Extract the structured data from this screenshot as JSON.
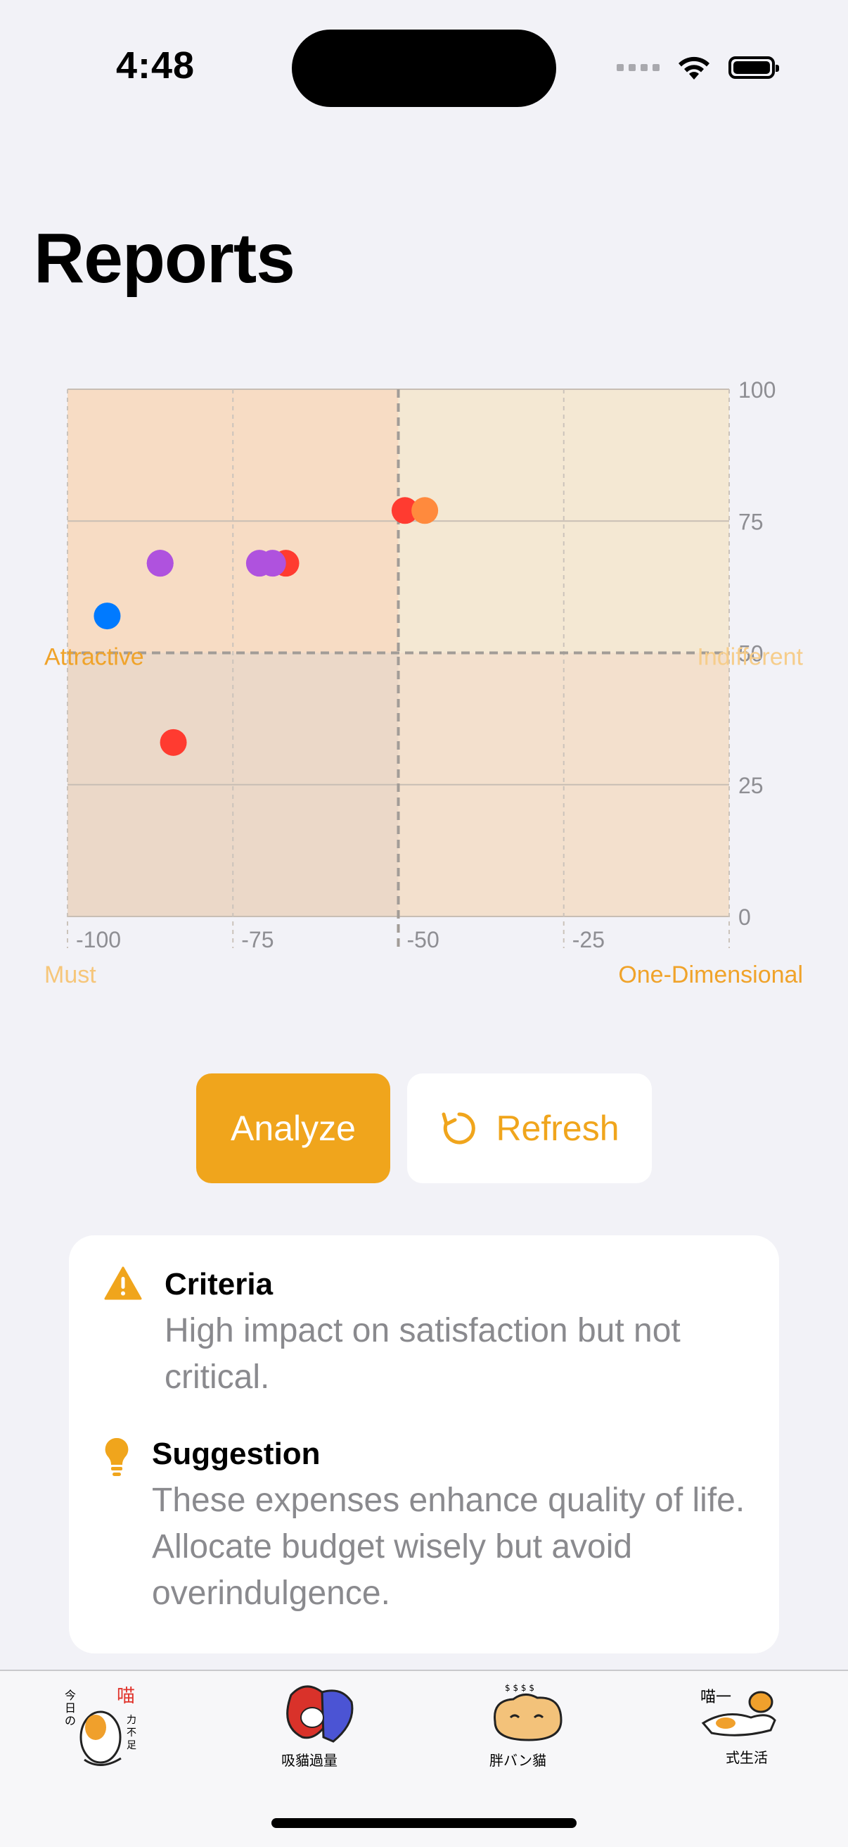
{
  "status": {
    "time": "4:48"
  },
  "page": {
    "title": "Reports"
  },
  "chart_data": {
    "type": "scatter",
    "xlim": [
      -100,
      0
    ],
    "ylim": [
      0,
      100
    ],
    "x_ticks": [
      "-100",
      "-75",
      "-50",
      "-25"
    ],
    "y_ticks": [
      "100",
      "75",
      "50",
      "25",
      "0"
    ],
    "quadrant_labels": {
      "top_left": "Attractive",
      "top_right": "Indifferent",
      "bottom_left": "Must",
      "bottom_right": "One-Dimensional"
    },
    "quadrant_colors": {
      "top_left": "#f7dcc4",
      "top_right": "#f4e8d3",
      "bottom_left": "#ebd8c8",
      "bottom_right": "#f3e0cd"
    },
    "divider": {
      "x": -50,
      "y": 50
    },
    "grid": true,
    "points": [
      {
        "x": -86,
        "y": 67,
        "color": "#af52de"
      },
      {
        "x": -86,
        "y": 67,
        "color": "#af52de"
      },
      {
        "x": -67,
        "y": 67,
        "color": "#ff3b30"
      },
      {
        "x": -71,
        "y": 67,
        "color": "#af52de"
      },
      {
        "x": -69,
        "y": 67,
        "color": "#af52de"
      },
      {
        "x": -94,
        "y": 57,
        "color": "#007aff"
      },
      {
        "x": -84,
        "y": 33,
        "color": "#ff3b30"
      },
      {
        "x": -49,
        "y": 77,
        "color": "#ff3b30"
      },
      {
        "x": -46,
        "y": 77,
        "color": "#ff8a3d"
      }
    ]
  },
  "actions": {
    "analyze_label": "Analyze",
    "refresh_label": "Refresh",
    "accent": "#f0a51c"
  },
  "info": {
    "criteria_title": "Criteria",
    "criteria_text": "High impact on satisfaction but not critical.",
    "suggestion_title": "Suggestion",
    "suggestion_text": "These expenses enhance quality of life. Allocate budget wisely but avoid overindulgence."
  },
  "tabs": [
    {
      "name": "tab-1",
      "icon": "cat-sticker-icon"
    },
    {
      "name": "tab-2",
      "icon": "capsule-sticker-icon"
    },
    {
      "name": "tab-3",
      "icon": "bread-sticker-icon"
    },
    {
      "name": "tab-4",
      "icon": "cat-lying-sticker-icon"
    }
  ]
}
